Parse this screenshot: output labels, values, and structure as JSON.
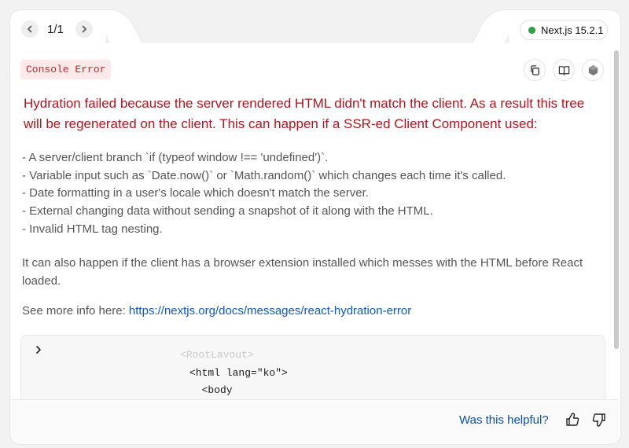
{
  "pager": {
    "text": "1/1"
  },
  "version": {
    "label": "Next.js 15.2.1",
    "status_color": "#2f9e44"
  },
  "error": {
    "badge": "Console Error",
    "title": "Hydration failed because the server rendered HTML didn't match the client. As a result this tree will be regenerated on the client. This can happen if a SSR-ed Client Component used:",
    "reasons": [
      "- A server/client branch `if (typeof window !== 'undefined')`.",
      "- Variable input such as `Date.now()` or `Math.random()` which changes each time it's called.",
      "- Date formatting in a user's locale which doesn't match the server.",
      "- External changing data without sending a snapshot of it along with the HTML.",
      "- Invalid HTML tag nesting."
    ],
    "extra": "It can also happen if the client has a browser extension installed which messes with the HTML before React loaded.",
    "more_info_prefix": "See more info here:",
    "more_info_link": "https://nextjs.org/docs/messages/react-hydration-error"
  },
  "code": {
    "faded_line": "<RootLayout>",
    "lines": [
      "<html lang=\"ko\">",
      "  <body"
    ]
  },
  "footer": {
    "helpful_label": "Was this helpful?"
  },
  "icons": {
    "prev": "chevron-left-icon",
    "next": "chevron-right-icon",
    "copy": "copy-icon",
    "docs": "book-icon",
    "node": "nodejs-icon",
    "thumbs_up": "thumbs-up-icon",
    "thumbs_down": "thumbs-down-icon"
  }
}
